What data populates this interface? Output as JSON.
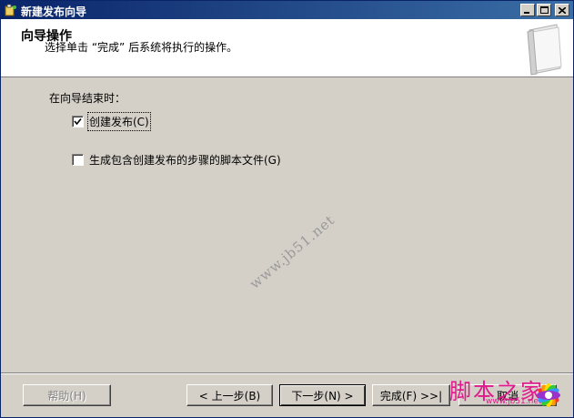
{
  "window": {
    "title": "新建发布向导",
    "title_icon": "wizard-icon"
  },
  "header": {
    "title": "向导操作",
    "subtitle": "选择单击 “完成” 后系统将执行的操作。"
  },
  "content": {
    "when_label": "在向导结束时：",
    "options": [
      {
        "label": "创建发布(C)",
        "checked": true
      },
      {
        "label": "生成包含创建发布的步骤的脚本文件(G)",
        "checked": false
      }
    ]
  },
  "watermark": {
    "text": "www.jb51.net"
  },
  "buttons": {
    "help": "帮助(H)",
    "back": "< 上一步(B)",
    "next": "下一步(N) >",
    "finish": "完成(F) >>|",
    "cancel": "取消"
  },
  "logo": {
    "text": "脚本之家",
    "sub": "www.jb51.net"
  },
  "colors": {
    "titlebar_start": "#0a246a",
    "titlebar_end": "#3a6ea5",
    "dialog_bg": "#d4d0c8",
    "logo_pink": "#e0188c"
  }
}
